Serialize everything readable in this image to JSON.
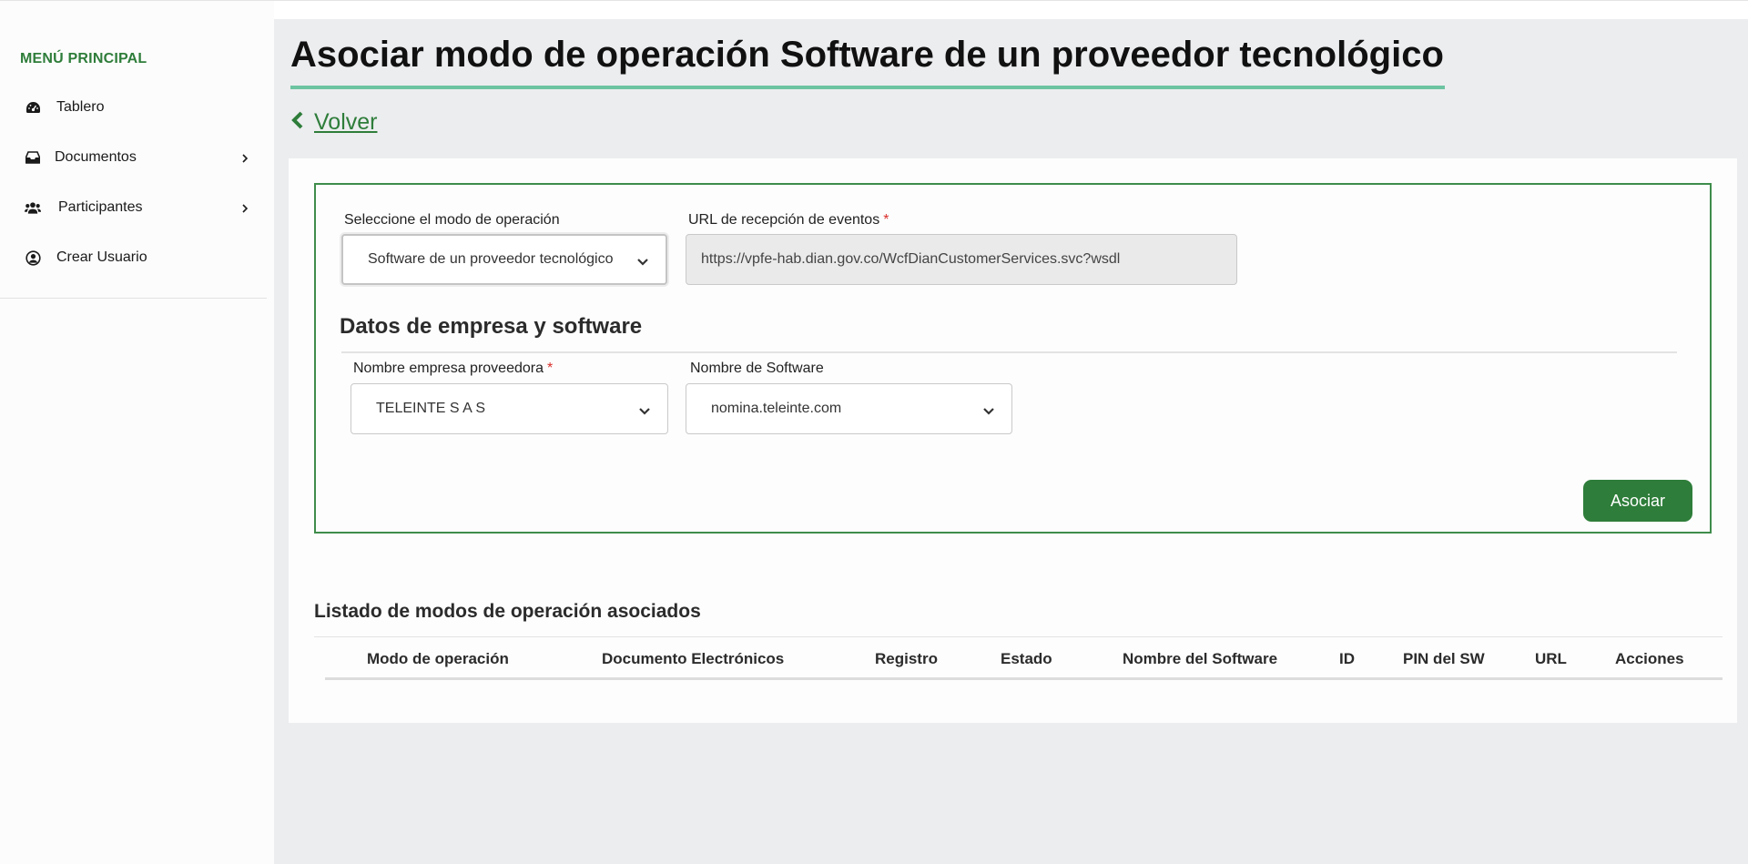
{
  "sidebar": {
    "menu_title": "MENÚ PRINCIPAL",
    "items": [
      {
        "label": "Tablero",
        "icon": "dashboard-icon",
        "has_submenu": false
      },
      {
        "label": "Documentos",
        "icon": "inbox-icon",
        "has_submenu": true
      },
      {
        "label": "Participantes",
        "icon": "users-icon",
        "has_submenu": true
      },
      {
        "label": "Crear Usuario",
        "icon": "user-circle-icon",
        "has_submenu": false
      }
    ]
  },
  "header": {
    "title": "Asociar modo de operación Software de un proveedor tecnológico",
    "back_label": "Volver"
  },
  "form": {
    "mode_label": "Seleccione el modo de operación",
    "mode_value": "Software de un proveedor tecnológico",
    "url_label": "URL de recepción de eventos",
    "url_required": "*",
    "url_value": "https://vpfe-hab.dian.gov.co/WcfDianCustomerServices.svc?wsdl",
    "section_heading": "Datos de empresa y software",
    "company_label": "Nombre empresa proveedora",
    "company_required": "*",
    "company_value": "TELEINTE S A S",
    "software_label": "Nombre de Software",
    "software_value": "nomina.teleinte.com",
    "submit_label": "Asociar"
  },
  "listing": {
    "title": "Listado de modos de operación asociados",
    "columns": [
      "Modo de operación",
      "Documento Electrónicos",
      "Registro",
      "Estado",
      "Nombre del Software",
      "ID",
      "PIN del SW",
      "URL",
      "Acciones"
    ],
    "rows": []
  },
  "colors": {
    "accent": "#2e7d3a",
    "title_underline": "#6cc4a1",
    "required": "#d9302c",
    "main_bg": "#ecedef"
  }
}
